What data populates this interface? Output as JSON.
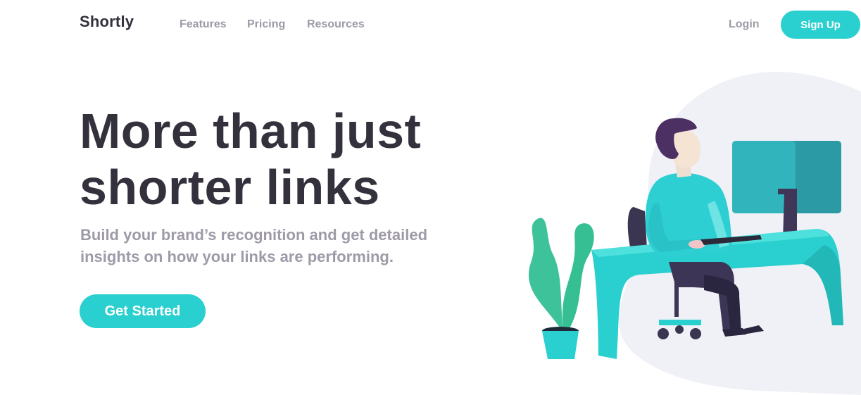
{
  "header": {
    "logo": "Shortly",
    "nav": [
      {
        "label": "Features"
      },
      {
        "label": "Pricing"
      },
      {
        "label": "Resources"
      }
    ],
    "login_label": "Login",
    "signup_label": "Sign Up"
  },
  "hero": {
    "title_line1": "More than just",
    "title_line2": "shorter links",
    "subtitle_line1": "Build your brand’s recognition and get detailed",
    "subtitle_line2": "insights on how your links are performing.",
    "cta_label": "Get Started"
  },
  "colors": {
    "accent": "#2acfcf",
    "dark_text": "#34313d",
    "muted_text": "#9e9aa8",
    "blob_bg": "#f0f1f6",
    "violet": "#4b3f6b"
  }
}
